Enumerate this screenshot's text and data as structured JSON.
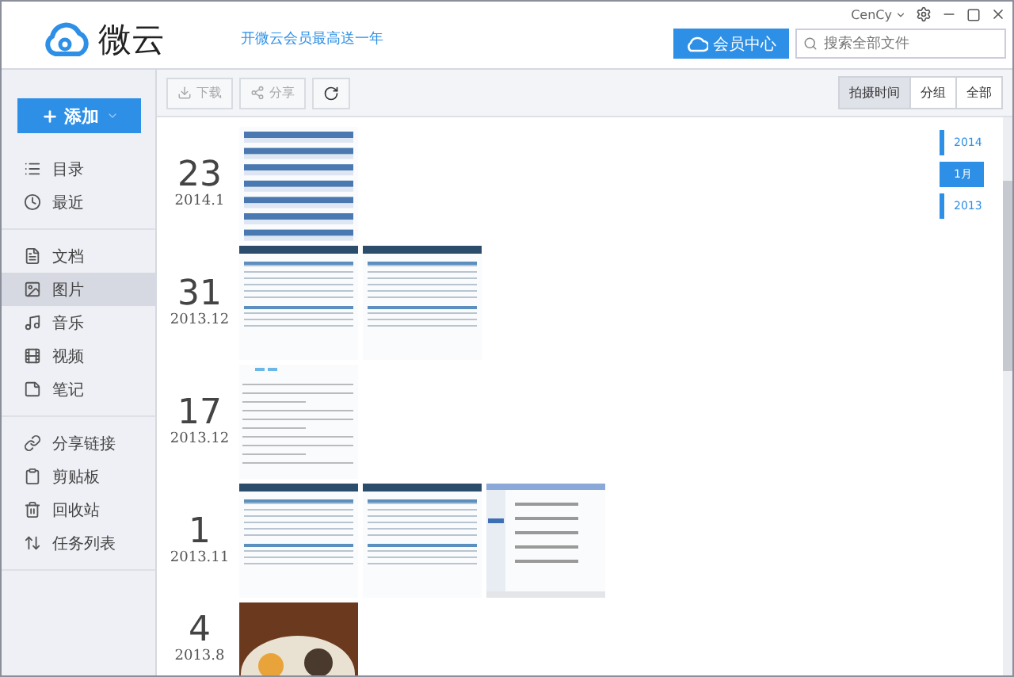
{
  "header": {
    "logo_text": "微云",
    "promo": "开微云会员最高送一年",
    "user": "CenCy",
    "vip_button": "会员中心",
    "search": {
      "placeholder": "搜索全部文件"
    }
  },
  "sidebar": {
    "add_button": "添加",
    "groups": [
      {
        "items": [
          {
            "label": "目录",
            "selected": false
          },
          {
            "label": "最近",
            "selected": false
          }
        ]
      },
      {
        "items": [
          {
            "label": "文档",
            "selected": false
          },
          {
            "label": "图片",
            "selected": true
          },
          {
            "label": "音乐",
            "selected": false
          },
          {
            "label": "视频",
            "selected": false
          },
          {
            "label": "笔记",
            "selected": false
          }
        ]
      },
      {
        "items": [
          {
            "label": "分享链接",
            "selected": false
          },
          {
            "label": "剪贴板",
            "selected": false
          },
          {
            "label": "回收站",
            "selected": false
          },
          {
            "label": "任务列表",
            "selected": false
          }
        ]
      }
    ]
  },
  "toolbar": {
    "buttons": [
      {
        "label": "下载",
        "disabled": true
      },
      {
        "label": "分享",
        "disabled": true
      }
    ],
    "view_tabs": [
      {
        "label": "拍摄时间",
        "selected": true
      },
      {
        "label": "分组",
        "selected": false
      },
      {
        "label": "全部",
        "selected": false
      }
    ]
  },
  "groups": [
    {
      "day": "23",
      "month": "2014.1",
      "thumbs": [
        {
          "kind": "flowchart"
        }
      ]
    },
    {
      "day": "31",
      "month": "2013.12",
      "thumbs": [
        {
          "kind": "table"
        },
        {
          "kind": "table"
        }
      ]
    },
    {
      "day": "17",
      "month": "2013.12",
      "thumbs": [
        {
          "kind": "document"
        }
      ]
    },
    {
      "day": "1",
      "month": "2013.11",
      "thumbs": [
        {
          "kind": "table"
        },
        {
          "kind": "table"
        },
        {
          "kind": "dialog"
        }
      ]
    },
    {
      "day": "4",
      "month": "2013.8",
      "thumbs": [
        {
          "kind": "photo"
        }
      ]
    }
  ],
  "timeline": [
    {
      "label": "2014",
      "kind": "year",
      "selected": false
    },
    {
      "label": "1月",
      "kind": "month",
      "selected": true
    },
    {
      "label": "2013",
      "kind": "year",
      "selected": false
    }
  ]
}
